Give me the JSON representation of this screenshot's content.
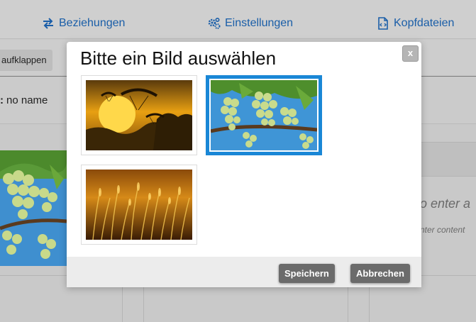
{
  "nav": {
    "relations_label": "Beziehungen",
    "settings_label": "Einstellungen",
    "header_files_label": "Kopfdateien"
  },
  "toolbar": {
    "expand_label": "aufklappen"
  },
  "record": {
    "name_key": ":",
    "name_value": "no name"
  },
  "editor": {
    "placeholder_large": "o enter a",
    "placeholder_small": "nter content"
  },
  "modal": {
    "title": "Bitte ein Bild auswählen",
    "close_label": "x",
    "images": [
      {
        "name": "paragliders-sunset",
        "selected": false
      },
      {
        "name": "grapes-vine",
        "selected": true
      },
      {
        "name": "golden-grass",
        "selected": false
      }
    ],
    "save_label": "Speichern",
    "cancel_label": "Abbrechen"
  },
  "colors": {
    "link": "#1a5ea8",
    "selected_border": "#1a87d6",
    "button_bg": "#6b6b6b"
  }
}
